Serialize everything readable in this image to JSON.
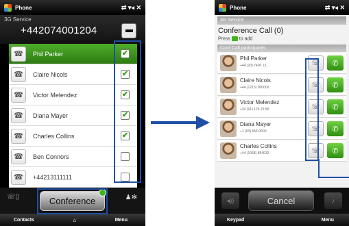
{
  "left_screen": {
    "status": {
      "app": "Phone",
      "icons": "⇄ ▾◂ ✕"
    },
    "service": "3G Service",
    "number": "+442074001204",
    "contacts": [
      {
        "name": "Phil Parker",
        "checked": true,
        "selected": true
      },
      {
        "name": "Claire Nicols",
        "checked": true,
        "selected": false
      },
      {
        "name": "Victor Melendez",
        "checked": true,
        "selected": false
      },
      {
        "name": "Diana Mayer",
        "checked": true,
        "selected": false
      },
      {
        "name": "Charles Collins",
        "checked": true,
        "selected": false
      },
      {
        "name": "Ben Connors",
        "checked": false,
        "selected": false
      },
      {
        "name": "+44213111111",
        "checked": false,
        "selected": false
      }
    ],
    "conference_label": "Conference",
    "softkeys": {
      "left": "Contacts",
      "center": "⌂",
      "right": "Menu"
    }
  },
  "right_screen": {
    "status": {
      "app": "Phone",
      "icons": "⇄ ▾◂ ✕"
    },
    "service": "3G Service",
    "title": "Conference Call (0)",
    "hint_pre": "Press",
    "hint_post": "to add",
    "section": "Conf Call participants",
    "participants": [
      {
        "name": "Phil Parker",
        "number": "+44 (20) 7400 12..."
      },
      {
        "name": "Claire Nicols",
        "number": "+44 (1213) 000000"
      },
      {
        "name": "Victor Melendez",
        "number": "+34 (91) 125 25 89"
      },
      {
        "name": "Diana Mayer",
        "number": "+1 (03) 555-0000"
      },
      {
        "name": "Charles Collins",
        "number": "+44 (1068) 854032"
      }
    ],
    "cancel_label": "Cancel",
    "softkeys": {
      "left": "Keypad",
      "right": "Menu"
    }
  },
  "colors": {
    "accent_green": "#3fb51e",
    "highlight_blue": "#1f4fa6",
    "arrow_blue": "#1f4fa6"
  }
}
